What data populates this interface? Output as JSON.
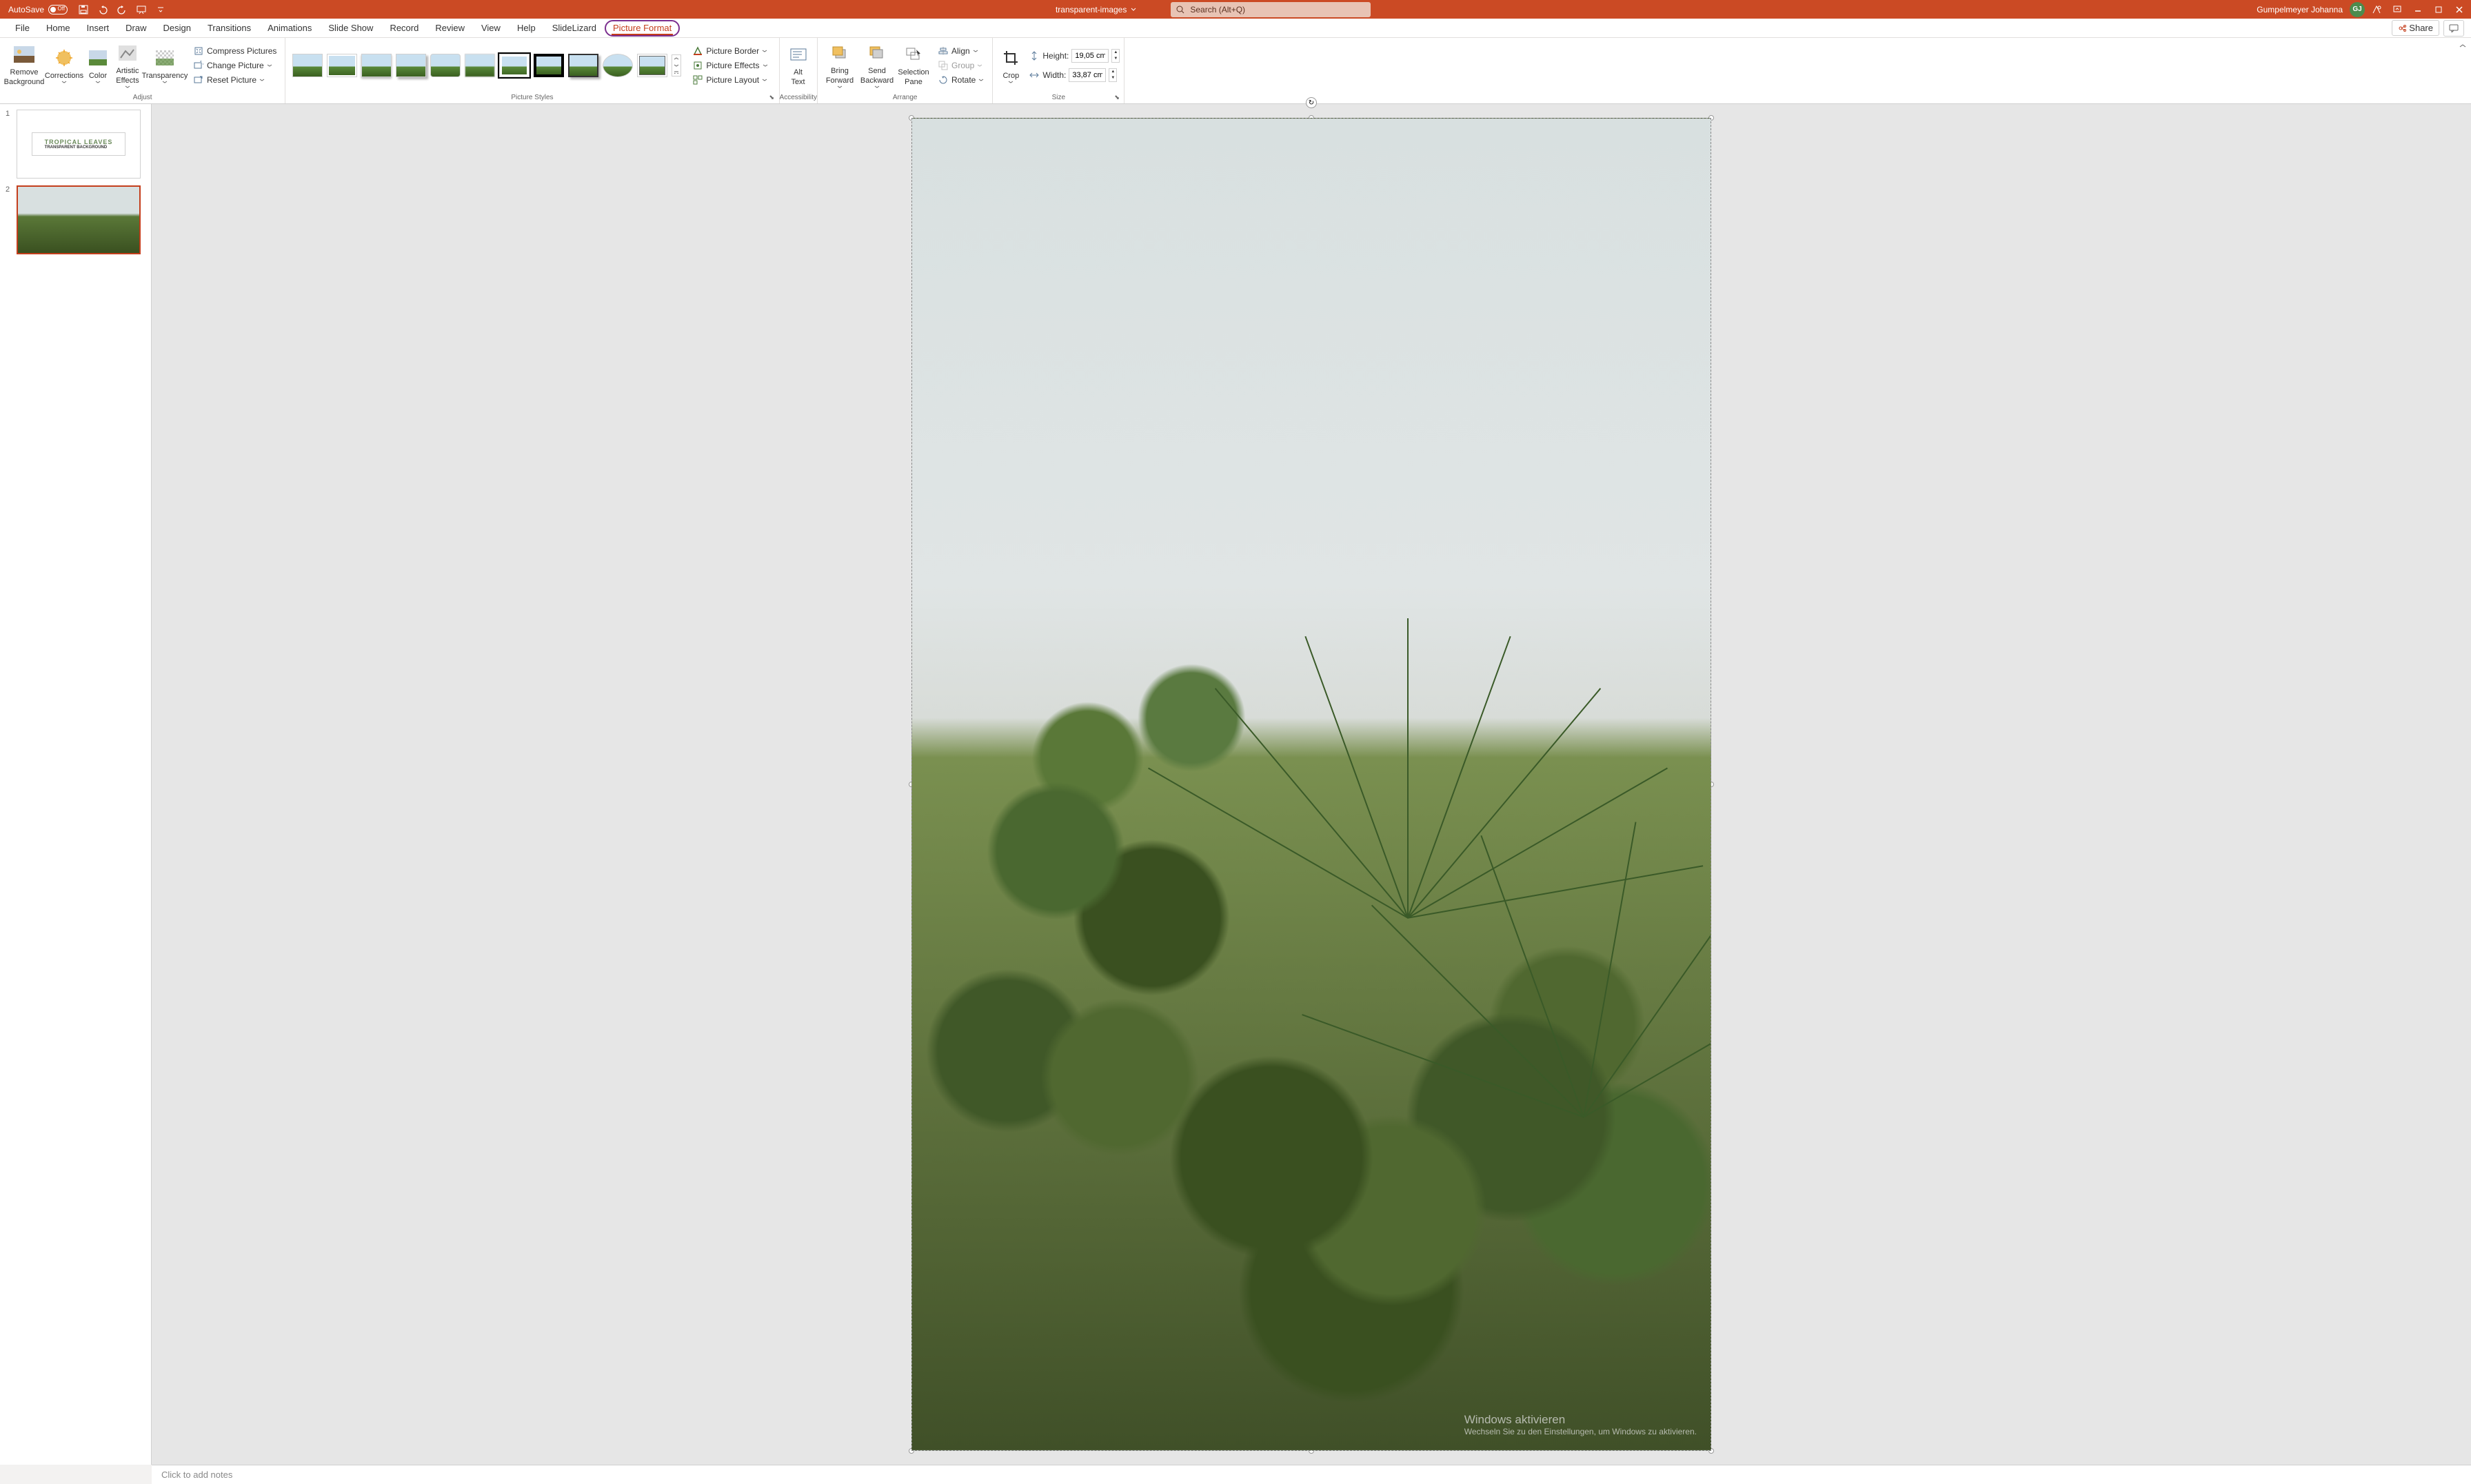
{
  "titlebar": {
    "autosave_label": "AutoSave",
    "autosave_state": "Off",
    "doc_name": "transparent-images",
    "search_placeholder": "Search (Alt+Q)",
    "user_name": "Gumpelmeyer Johanna",
    "avatar_initials": "GJ"
  },
  "tabs": {
    "items": [
      "File",
      "Home",
      "Insert",
      "Draw",
      "Design",
      "Transitions",
      "Animations",
      "Slide Show",
      "Record",
      "Review",
      "View",
      "Help",
      "SlideLizard",
      "Picture Format"
    ],
    "share_label": "Share"
  },
  "ribbon": {
    "groups": {
      "adjust": {
        "label": "Adjust",
        "remove_bg": "Remove\nBackground",
        "corrections": "Corrections",
        "color": "Color",
        "artistic": "Artistic\nEffects",
        "transparency": "Transparency",
        "compress": "Compress Pictures",
        "change": "Change Picture",
        "reset": "Reset Picture"
      },
      "styles": {
        "label": "Picture Styles",
        "border": "Picture Border",
        "effects": "Picture Effects",
        "layout": "Picture Layout"
      },
      "accessibility": {
        "label": "Accessibility",
        "alt_text": "Alt\nText"
      },
      "arrange": {
        "label": "Arrange",
        "bring_forward": "Bring\nForward",
        "send_backward": "Send\nBackward",
        "selection_pane": "Selection\nPane",
        "align": "Align",
        "group": "Group",
        "rotate": "Rotate"
      },
      "size": {
        "label": "Size",
        "crop": "Crop",
        "height_label": "Height:",
        "height_value": "19,05 cm",
        "width_label": "Width:",
        "width_value": "33,87 cm"
      }
    }
  },
  "slides": {
    "thumb1_title": "TROPICAL LEAVES",
    "thumb1_sub": "TRANSPARENT BACKGROUND"
  },
  "watermark": {
    "title": "Windows aktivieren",
    "sub": "Wechseln Sie zu den Einstellungen, um Windows zu aktivieren."
  },
  "notes_placeholder": "Click to add notes"
}
